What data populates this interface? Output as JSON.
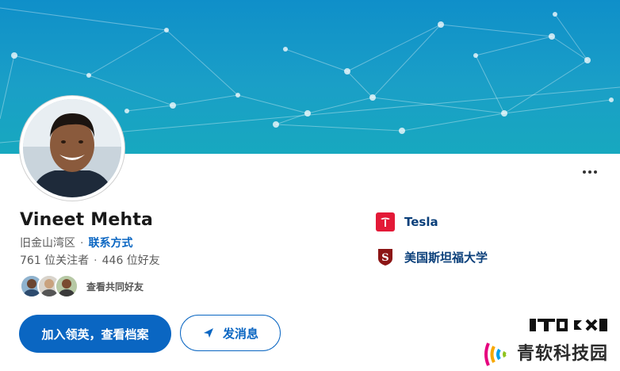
{
  "profile": {
    "name": "Vineet Mehta",
    "location": "旧金山湾区",
    "contact_link": "联系方式",
    "followers": "761 位关注者",
    "connections": "446 位好友",
    "separator": "·",
    "mutual_link": "查看共同好友"
  },
  "actions": {
    "join_label": "加入领英，查看档案",
    "message_label": "发消息"
  },
  "organizations": [
    {
      "name": "Tesla",
      "logo_color": "#e31937",
      "icon": "tesla-logo"
    },
    {
      "name": "美国斯坦福大学",
      "logo_color": "#ffffff",
      "icon": "stanford-logo"
    }
  ],
  "watermark": {
    "text": "青软科技园"
  },
  "colors": {
    "accent": "#0a66c2",
    "banner": "#1a9fc7"
  }
}
